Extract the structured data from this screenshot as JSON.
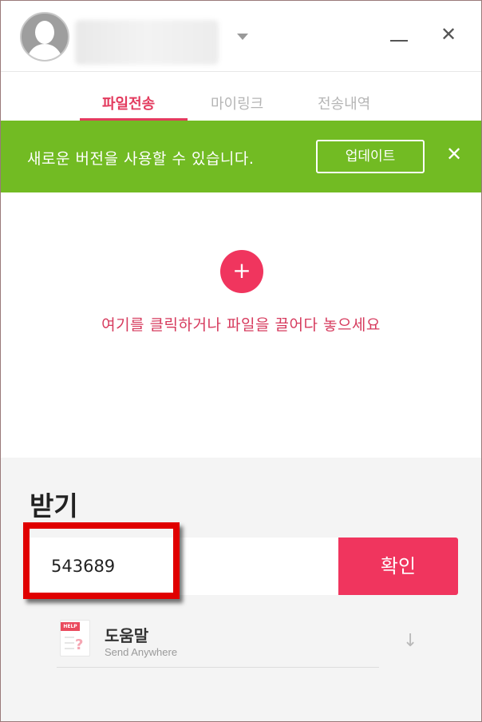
{
  "header": {
    "account_name": "",
    "icons": [
      "avatar",
      "chevron-down-icon",
      "minimize-icon",
      "close-icon"
    ]
  },
  "tabs": [
    {
      "label": "파일전송",
      "active": true
    },
    {
      "label": "마이링크",
      "active": false
    },
    {
      "label": "전송내역",
      "active": false
    }
  ],
  "banner": {
    "message": "새로운 버전을 사용할 수 있습니다.",
    "update_label": "업데이트",
    "color": "#72bb23"
  },
  "dropzone": {
    "add_icon": "+",
    "hint": "여기를 클릭하거나 파일을 끌어다 놓으세요"
  },
  "receive": {
    "title": "받기",
    "code_value": "543689",
    "confirm_label": "확인"
  },
  "help": {
    "title": "도움말",
    "subtitle": "Send Anywhere",
    "icon_tag": "HELP"
  },
  "colors": {
    "accent": "#f0355e",
    "tab_active": "#e33b5e",
    "banner": "#72bb23",
    "highlight": "#e00000"
  }
}
